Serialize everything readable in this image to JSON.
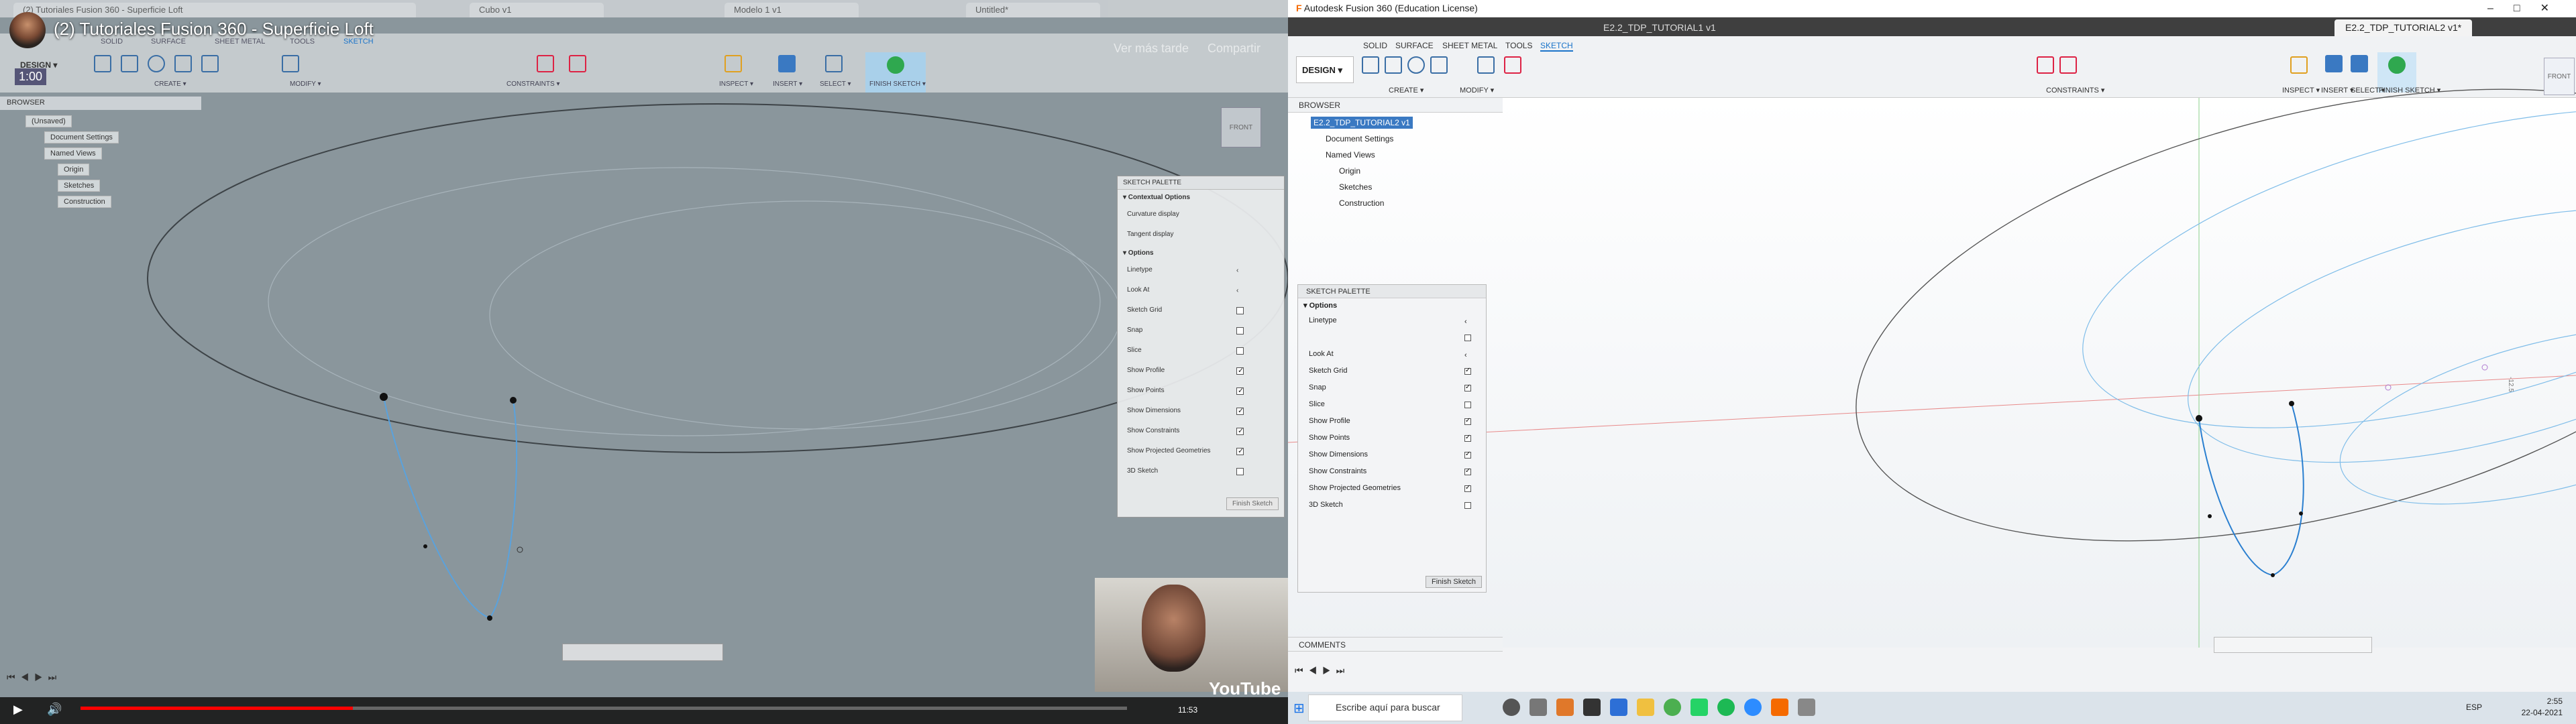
{
  "left": {
    "browser_tabs": [
      "(2) Tutoriales Fusion 360 - Superficie Loft",
      "Cubo v1",
      "Modelo 1 v1",
      "Untitled*"
    ],
    "title_bar": "Autodesk Fusion 360 (Education License)",
    "video_title": "(2) Tutoriales Fusion 360 - Superficie Loft",
    "time_badge": "1:00",
    "overlay_labels": [
      "Ver más tarde",
      "Compartir"
    ],
    "modes": [
      "SOLID",
      "SURFACE",
      "SHEET METAL",
      "TOOLS",
      "SKETCH"
    ],
    "design_label": "DESIGN ▾",
    "groups": [
      "CREATE ▾",
      "MODIFY ▾",
      "CONSTRAINTS ▾",
      "INSPECT ▾",
      "INSERT ▾",
      "SELECT ▾",
      "FINISH SKETCH ▾"
    ],
    "browser_header": "BROWSER",
    "browser_items": [
      "(Unsaved)",
      "Document Settings",
      "Named Views",
      "Origin",
      "Sketches",
      "Construction"
    ],
    "view_cube": "FRONT",
    "palette": {
      "title": "SKETCH PALETTE",
      "contextual_header": "▾ Contextual Options",
      "contextual": [
        "Curvature display",
        "Tangent display"
      ],
      "options_header": "▾ Options",
      "rows": [
        {
          "label": "Linetype",
          "checked": null
        },
        {
          "label": "Look At",
          "checked": null
        },
        {
          "label": "Sketch Grid",
          "checked": false
        },
        {
          "label": "Snap",
          "checked": false
        },
        {
          "label": "Slice",
          "checked": false
        },
        {
          "label": "Show Profile",
          "checked": true
        },
        {
          "label": "Show Points",
          "checked": true
        },
        {
          "label": "Show Dimensions",
          "checked": true
        },
        {
          "label": "Show Constraints",
          "checked": true
        },
        {
          "label": "Show Projected Geometries",
          "checked": true
        },
        {
          "label": "3D Sketch",
          "checked": false
        }
      ],
      "finish": "Finish Sketch"
    },
    "player_time": "11:53",
    "youtube_label": "YouTube"
  },
  "right": {
    "app_title": "Autodesk Fusion 360 (Education License)",
    "tabs": [
      "E2.2_TDP_TUTORIAL1 v1",
      "E2.2_TDP_TUTORIAL2 v1*"
    ],
    "modes": [
      "SOLID",
      "SURFACE",
      "SHEET METAL",
      "TOOLS",
      "SKETCH"
    ],
    "design_label": "DESIGN ▾",
    "groups": [
      "CREATE ▾",
      "MODIFY ▾",
      "CONSTRAINTS ▾",
      "INSPECT ▾",
      "INSERT ▾",
      "SELECT ▾",
      "FINISH SKETCH ▾"
    ],
    "browser_header": "BROWSER",
    "browser_items": [
      "E2.2_TDP_TUTORIAL2 v1",
      "Document Settings",
      "Named Views",
      "Origin",
      "Sketches",
      "Construction"
    ],
    "view_cube": "FRONT",
    "dimension_label": "-12.5",
    "palette": {
      "title": "SKETCH PALETTE",
      "options_header": "▾ Options",
      "rows": [
        {
          "label": "Linetype",
          "checked": null
        },
        {
          "label": "",
          "checked": false
        },
        {
          "label": "Look At",
          "checked": null
        },
        {
          "label": "Sketch Grid",
          "checked": true
        },
        {
          "label": "Snap",
          "checked": true
        },
        {
          "label": "Slice",
          "checked": false
        },
        {
          "label": "Show Profile",
          "checked": true
        },
        {
          "label": "Show Points",
          "checked": true
        },
        {
          "label": "Show Dimensions",
          "checked": true
        },
        {
          "label": "Show Constraints",
          "checked": true
        },
        {
          "label": "Show Projected Geometries",
          "checked": true
        },
        {
          "label": "3D Sketch",
          "checked": false
        }
      ],
      "finish": "Finish Sketch"
    },
    "comments": "COMMENTS",
    "taskbar": {
      "search_placeholder": "Escribe aquí para buscar",
      "lang": "ESP",
      "time": "2:55",
      "date": "22-04-2021"
    }
  },
  "colors": {
    "sketch_blue": "#3b8fd8",
    "accent": "#1b74c9",
    "finish_green": "#2fa84f"
  }
}
